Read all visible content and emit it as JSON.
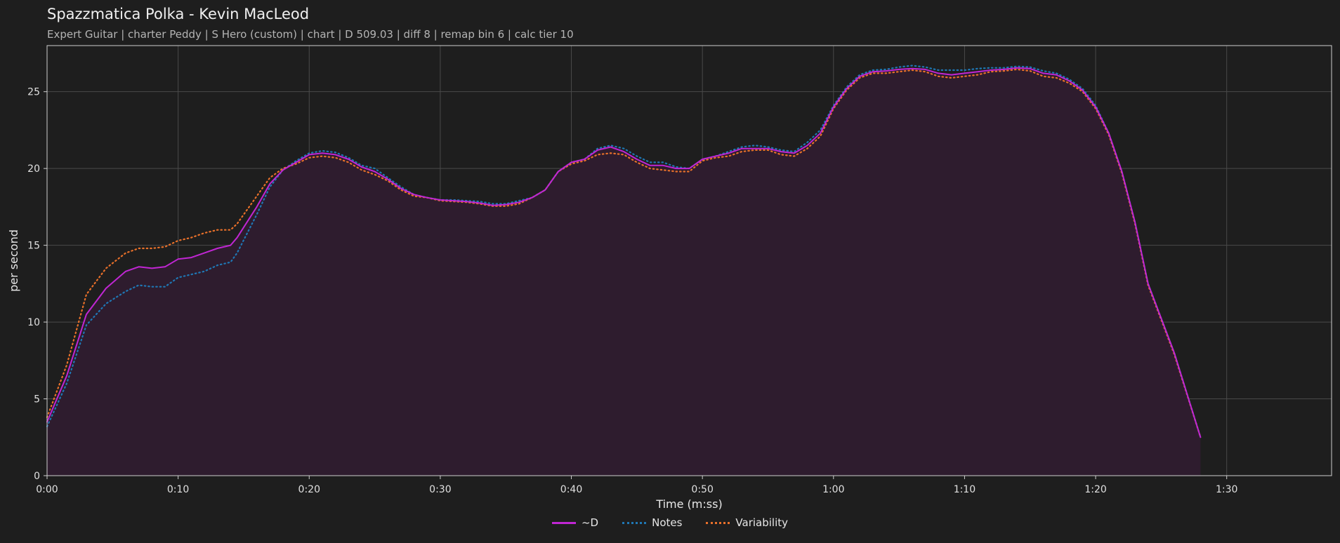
{
  "header": {
    "title": "Spazzmatica Polka - Kevin MacLeod",
    "subtitle": "Expert Guitar  |  charter Peddy  |  S Hero (custom)  |  chart  |  D 509.03  |  diff 8  |  remap bin 6  |  calc tier 10"
  },
  "colors": {
    "background": "#1e1e1e",
    "D": "#c026d3",
    "notes": "#1f77b4",
    "variability": "#e8702a",
    "fill": "#2e1c2e",
    "grid": "#4a4a4a"
  },
  "chart_data": {
    "type": "line",
    "xlabel": "Time (m:ss)",
    "ylabel": "per second",
    "xlim": [
      0,
      98
    ],
    "ylim": [
      0,
      28
    ],
    "x_ticks": [
      0,
      10,
      20,
      30,
      40,
      50,
      60,
      70,
      80,
      90
    ],
    "x_tick_labels": [
      "0:00",
      "0:10",
      "0:20",
      "0:30",
      "0:40",
      "0:50",
      "1:00",
      "1:10",
      "1:20",
      "1:30"
    ],
    "y_ticks": [
      0,
      5,
      10,
      15,
      20,
      25
    ],
    "grid": true,
    "legend_position": "bottom-center",
    "x": [
      0,
      1,
      2,
      3,
      4,
      5,
      6,
      7,
      8,
      9,
      10,
      11,
      12,
      13,
      14,
      15,
      16,
      17,
      18,
      19,
      20,
      21,
      22,
      23,
      24,
      25,
      26,
      27,
      28,
      29,
      30,
      31,
      32,
      33,
      34,
      35,
      36,
      37,
      38,
      39,
      40,
      41,
      42,
      43,
      44,
      45,
      46,
      47,
      48,
      49,
      50,
      51,
      52,
      53,
      54,
      55,
      56,
      57,
      58,
      59,
      60,
      61,
      62,
      63,
      64,
      65,
      66,
      67,
      68,
      69,
      70,
      71,
      72,
      73,
      74,
      75,
      76,
      77,
      78,
      79,
      80,
      81,
      82,
      83,
      84,
      85,
      86,
      87,
      88,
      89,
      90,
      91,
      92,
      93,
      94,
      95,
      96,
      97,
      98
    ],
    "series": [
      {
        "name": "~D",
        "style": "solid",
        "color": "#c026d3",
        "values": [
          3.5,
          6.5,
          10.5,
          12.2,
          13.3,
          13.6,
          13.5,
          13.6,
          14.1,
          14.2,
          14.5,
          14.8,
          15.0,
          15.5,
          17.5,
          19.0,
          19.9,
          20.4,
          20.9,
          21.0,
          20.9,
          20.6,
          20.1,
          19.8,
          19.3,
          18.7,
          18.3,
          18.1,
          17.95,
          17.9,
          17.85,
          17.75,
          17.6,
          17.65,
          17.8,
          18.1,
          18.6,
          19.8,
          20.4,
          20.6,
          21.2,
          21.4,
          21.1,
          20.6,
          20.2,
          20.2,
          20.0,
          20.0,
          20.6,
          20.8,
          21.0,
          21.3,
          21.3,
          21.3,
          21.1,
          21.0,
          21.5,
          22.3,
          24.0,
          25.2,
          26.0,
          26.3,
          26.35,
          26.45,
          26.5,
          26.45,
          26.2,
          26.1,
          26.2,
          26.3,
          26.4,
          26.45,
          26.55,
          26.5,
          26.2,
          26.1,
          25.7,
          25.1,
          24.0,
          22.3,
          19.8,
          16.5,
          12.5,
          8.0,
          2.5
        ]
      },
      {
        "name": "Notes",
        "style": "dotted",
        "color": "#1f77b4",
        "values": [
          3.2,
          6.0,
          9.8,
          11.2,
          12.0,
          12.4,
          12.3,
          12.3,
          12.9,
          13.1,
          13.3,
          13.7,
          13.9,
          14.5,
          17.0,
          18.8,
          19.9,
          20.5,
          21.0,
          21.15,
          21.05,
          20.7,
          20.2,
          20.0,
          19.4,
          18.8,
          18.3,
          18.1,
          17.95,
          17.95,
          17.9,
          17.85,
          17.7,
          17.7,
          17.9,
          18.1,
          18.6,
          19.8,
          20.4,
          20.6,
          21.3,
          21.5,
          21.3,
          20.8,
          20.4,
          20.4,
          20.1,
          20.0,
          20.6,
          20.8,
          21.1,
          21.4,
          21.5,
          21.4,
          21.2,
          21.1,
          21.7,
          22.5,
          24.1,
          25.3,
          26.1,
          26.4,
          26.45,
          26.6,
          26.7,
          26.6,
          26.4,
          26.4,
          26.4,
          26.5,
          26.55,
          26.55,
          26.65,
          26.6,
          26.35,
          26.2,
          25.8,
          25.2,
          24.1,
          22.3,
          19.8,
          16.5,
          12.5,
          8.0,
          2.5
        ]
      },
      {
        "name": "Variability",
        "style": "dotted",
        "color": "#e8702a",
        "values": [
          3.8,
          7.2,
          11.8,
          13.5,
          14.5,
          14.8,
          14.8,
          14.9,
          15.3,
          15.5,
          15.8,
          16.0,
          16.0,
          16.4,
          18.2,
          19.4,
          20.0,
          20.3,
          20.7,
          20.8,
          20.7,
          20.4,
          19.9,
          19.6,
          19.2,
          18.6,
          18.2,
          18.1,
          17.9,
          17.85,
          17.8,
          17.7,
          17.55,
          17.55,
          17.7,
          18.1,
          18.6,
          19.8,
          20.3,
          20.5,
          20.9,
          21.0,
          20.9,
          20.4,
          20.0,
          19.9,
          19.8,
          19.8,
          20.5,
          20.7,
          20.8,
          21.1,
          21.2,
          21.2,
          20.9,
          20.8,
          21.3,
          22.1,
          23.9,
          25.1,
          25.9,
          26.2,
          26.2,
          26.3,
          26.4,
          26.3,
          26.0,
          25.9,
          26.0,
          26.1,
          26.3,
          26.35,
          26.45,
          26.35,
          26.0,
          25.9,
          25.55,
          25.0,
          23.9,
          22.2,
          19.7,
          16.4,
          12.4,
          7.9,
          2.5
        ]
      }
    ],
    "series_x": [
      0,
      1.5,
      3,
      4.5,
      6,
      7,
      8,
      9,
      10,
      11,
      12,
      13,
      14,
      14.5,
      16,
      17,
      18,
      19,
      20,
      21,
      22,
      23,
      24,
      25,
      26,
      27,
      28,
      29,
      30,
      31,
      32,
      33,
      34,
      35,
      36,
      37,
      38,
      39,
      40,
      41,
      42,
      43,
      44,
      45,
      46,
      47,
      48,
      49,
      50,
      51,
      52,
      53,
      54,
      55,
      56,
      57,
      58,
      59,
      60,
      61,
      62,
      63,
      64,
      65,
      66,
      67,
      68,
      69,
      70,
      71,
      72,
      73,
      74,
      75,
      76,
      77,
      78,
      79,
      80,
      81,
      82,
      83,
      84,
      86,
      88
    ]
  },
  "legend": [
    {
      "label": "~D",
      "color": "#c026d3",
      "style": "solid"
    },
    {
      "label": "Notes",
      "color": "#1f77b4",
      "style": "dotted"
    },
    {
      "label": "Variability",
      "color": "#e8702a",
      "style": "dotted"
    }
  ]
}
